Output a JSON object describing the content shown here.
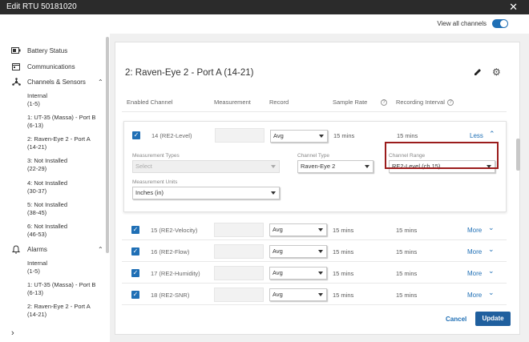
{
  "window": {
    "title": "Edit RTU 50181020"
  },
  "toggle": {
    "label": "View all channels",
    "on": true
  },
  "sidebar": {
    "battery": "Battery Status",
    "communications": "Communications",
    "channels": {
      "label": "Channels & Sensors",
      "items": [
        [
          "Internal",
          "(1-5)"
        ],
        [
          "1: UT-35 (Massa) - Port B",
          "(6-13)"
        ],
        [
          "2: Raven-Eye 2 - Port A",
          "(14-21)"
        ],
        [
          "3: Not Installed",
          "(22-29)"
        ],
        [
          "4: Not Installed",
          "(30-37)"
        ],
        [
          "5: Not Installed",
          "(38-45)"
        ],
        [
          "6: Not Installed",
          "(46-53)"
        ]
      ]
    },
    "alarms": {
      "label": "Alarms",
      "items": [
        [
          "Internal",
          "(1-5)"
        ],
        [
          "1: UT-35 (Massa) - Port B",
          "(6-13)"
        ],
        [
          "2: Raven-Eye 2 - Port A",
          "(14-21)"
        ]
      ]
    }
  },
  "panel": {
    "title": "2: Raven-Eye 2 - Port A (14-21)",
    "headers": {
      "enabled": "Enabled Channel",
      "measurement": "Measurement",
      "record": "Record",
      "sample": "Sample Rate",
      "interval": "Recording Interval"
    },
    "expanded": {
      "channel": "14 (RE2-Level)",
      "record": "Avg",
      "sample": "15 mins",
      "interval": "15 mins",
      "toggle": "Less",
      "mtypes_label": "Measurement Types",
      "mtypes_value": "Select",
      "ctype_label": "Channel Type",
      "ctype_value": "Raven-Eye 2",
      "crange_label": "Channel Range",
      "crange_value": "RE2-Level (ch 15)",
      "munits_label": "Measurement Units",
      "munits_value": "Inches (in)"
    },
    "rows": [
      {
        "channel": "15 (RE2-Velocity)",
        "record": "Avg",
        "sample": "15 mins",
        "interval": "15 mins",
        "toggle": "More"
      },
      {
        "channel": "16 (RE2-Flow)",
        "record": "Avg",
        "sample": "15 mins",
        "interval": "15 mins",
        "toggle": "More"
      },
      {
        "channel": "17 (RE2-Humidity)",
        "record": "Avg",
        "sample": "15 mins",
        "interval": "15 mins",
        "toggle": "More"
      },
      {
        "channel": "18 (RE2-SNR)",
        "record": "Avg",
        "sample": "15 mins",
        "interval": "15 mins",
        "toggle": "More"
      }
    ],
    "cancel": "Cancel",
    "update": "Update"
  },
  "colors": {
    "accent": "#1f6fb5",
    "highlight": "#9b1c1c",
    "titlebar": "#2b2b2b"
  }
}
